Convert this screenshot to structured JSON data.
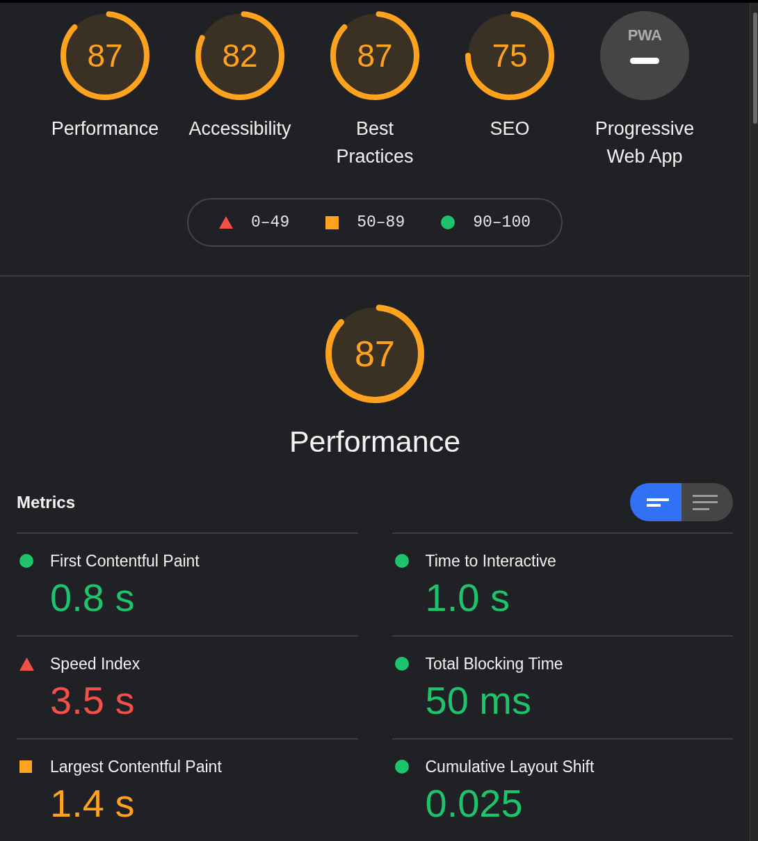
{
  "categories": [
    {
      "kind": "score",
      "score": "87",
      "level": 0.87,
      "label": "Performance"
    },
    {
      "kind": "score",
      "score": "82",
      "level": 0.82,
      "label": "Accessibility"
    },
    {
      "kind": "score",
      "score": "87",
      "level": 0.87,
      "label": "Best Practices"
    },
    {
      "kind": "score",
      "score": "75",
      "level": 0.75,
      "label": "SEO"
    },
    {
      "kind": "pwa",
      "badge": "PWA",
      "label": "Progressive Web App"
    }
  ],
  "legend": [
    {
      "kind": "fail",
      "label": "0–49"
    },
    {
      "kind": "average",
      "label": "50–89"
    },
    {
      "kind": "pass",
      "label": "90–100"
    }
  ],
  "performance": {
    "score": "87",
    "level": 0.87,
    "title": "Performance"
  },
  "metrics_header": {
    "title": "Metrics",
    "view_toggle": [
      {
        "kind": "compact",
        "selected": true
      },
      {
        "kind": "full",
        "selected": false
      }
    ]
  },
  "metrics": [
    {
      "kind": "pass",
      "title": "First Contentful Paint",
      "value": "0.8 s"
    },
    {
      "kind": "pass",
      "title": "Time to Interactive",
      "value": "1.0 s"
    },
    {
      "kind": "fail",
      "title": "Speed Index",
      "value": "3.5 s"
    },
    {
      "kind": "pass",
      "title": "Total Blocking Time",
      "value": "50 ms"
    },
    {
      "kind": "average",
      "title": "Largest Contentful Paint",
      "value": "1.4 s"
    },
    {
      "kind": "pass",
      "title": "Cumulative Layout Shift",
      "value": "0.025"
    }
  ]
}
